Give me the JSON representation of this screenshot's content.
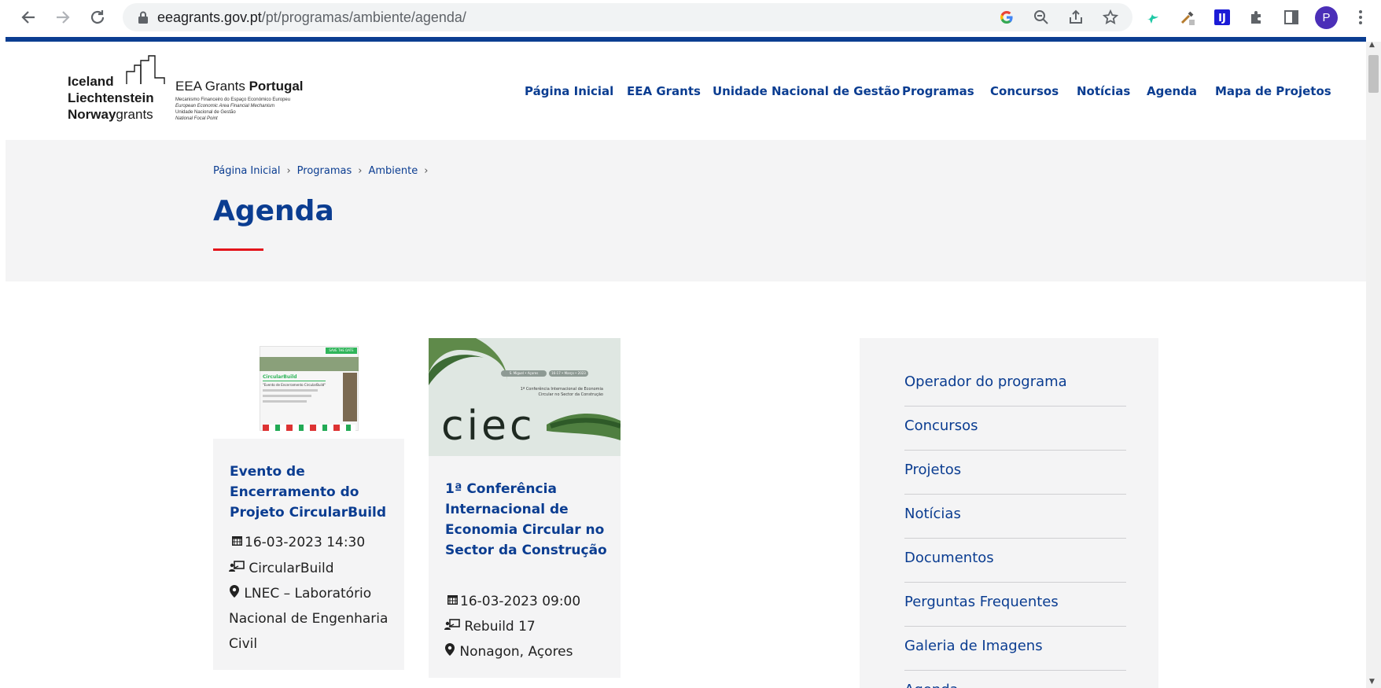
{
  "browser": {
    "url_host": "eeagrants.gov.pt",
    "url_path": "/pt/programas/ambiente/agenda/",
    "avatar_letter": "P"
  },
  "logo": {
    "line1": "Iceland",
    "line2": "Liechtenstein",
    "line3_bold": "Norway",
    "line3_thin": "grants",
    "brand_thin": "EEA Grants",
    "brand_bold": "Portugal",
    "sub1": "Mecanismo Financeiro do Espaço Económico Europeu",
    "sub2": "European Economic Area Financial Mechanism",
    "sub3": "Unidade Nacional de Gestão",
    "sub4": "National Focal Point"
  },
  "nav": [
    {
      "label": "Página Inicial"
    },
    {
      "label": "EEA Grants"
    },
    {
      "label": "Unidade Nacional de Gestão"
    },
    {
      "label": "Programas"
    },
    {
      "label": "Concursos"
    },
    {
      "label": "Notícias"
    },
    {
      "label": "Agenda"
    },
    {
      "label": "Mapa de Projetos"
    }
  ],
  "breadcrumb": [
    {
      "label": "Página Inicial"
    },
    {
      "label": "Programas"
    },
    {
      "label": "Ambiente"
    }
  ],
  "breadcrumb_sep": "›",
  "page_title": "Agenda",
  "events": [
    {
      "title": "Evento de Encerramento do Projeto CircularBuild",
      "date": "16-03-2023 14:30",
      "project": "CircularBuild",
      "location": "LNEC – Laboratório Nacional de Engenharia Civil",
      "poster": {
        "badge": "SAVE THE DATE",
        "heading": "CircularBuild",
        "line": "\"Evento de Encerramento CircularBuild\""
      }
    },
    {
      "title": "1ª Conferência Internacional de Economia Circular no Sector da Construção",
      "date": "16-03-2023 09:00",
      "project": "Rebuild 17",
      "location": "Nonagon, Açores",
      "poster": {
        "logo": "CIEC",
        "pill1": "S. Miguel • Açores",
        "pill2": "16-17 • Março • 2023",
        "sub": "1ª Conferência Internacional de Economia Circular no Sector da Construção"
      }
    }
  ],
  "sidebar": [
    {
      "label": "Operador do programa"
    },
    {
      "label": "Concursos"
    },
    {
      "label": "Projetos"
    },
    {
      "label": "Notícias"
    },
    {
      "label": "Documentos"
    },
    {
      "label": "Perguntas Frequentes"
    },
    {
      "label": "Galeria de Imagens"
    },
    {
      "label": "Agenda"
    }
  ],
  "colors": {
    "brand_blue": "#0b3d91",
    "accent_red": "#e3141b",
    "panel_gray": "#f4f4f5"
  },
  "icons": {
    "date": "calendar-icon",
    "project": "presenter-icon",
    "location": "map-marker-icon"
  }
}
